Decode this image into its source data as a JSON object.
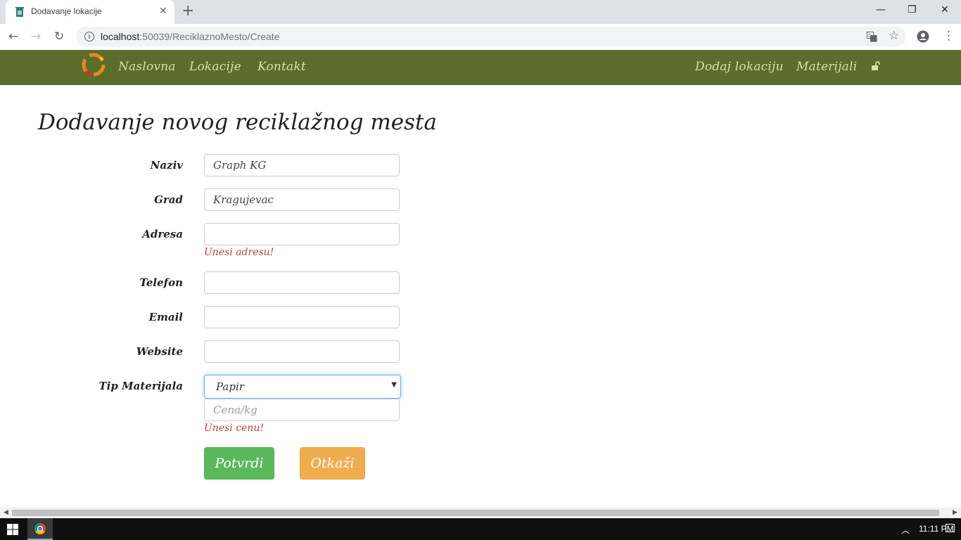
{
  "browser": {
    "tab_title": "Dodavanje lokacije",
    "url_host": "localhost",
    "url_path": ":50039/ReciklaznoMesto/Create"
  },
  "navbar": {
    "left_links": [
      "Naslovna",
      "Lokacije",
      "Kontakt"
    ],
    "right_links": [
      "Dodaj lokaciju",
      "Materijali"
    ],
    "colors": {
      "background": "#5b6d2b",
      "link": "#d6e3a9"
    }
  },
  "page": {
    "title": "Dodavanje novog reciklažnog mesta"
  },
  "form": {
    "naziv": {
      "label": "Naziv",
      "value": "Graph KG"
    },
    "grad": {
      "label": "Grad",
      "value": "Kragujevac"
    },
    "adresa": {
      "label": "Adresa",
      "value": "",
      "error": "Unesi adresu!"
    },
    "telefon": {
      "label": "Telefon",
      "value": ""
    },
    "email": {
      "label": "Email",
      "value": ""
    },
    "website": {
      "label": "Website",
      "value": ""
    },
    "tip_materijala": {
      "label": "Tip Materijala",
      "selected": "Papir"
    },
    "cena": {
      "placeholder": "Cena/kg",
      "value": "",
      "error": "Unesi cenu!"
    },
    "submit_label": "Potvrdi",
    "cancel_label": "Otkaži",
    "colors": {
      "submit": "#5cb85c",
      "cancel": "#f0ad4e",
      "error": "#a94442"
    }
  },
  "taskbar": {
    "clock": "11:11 PM"
  }
}
